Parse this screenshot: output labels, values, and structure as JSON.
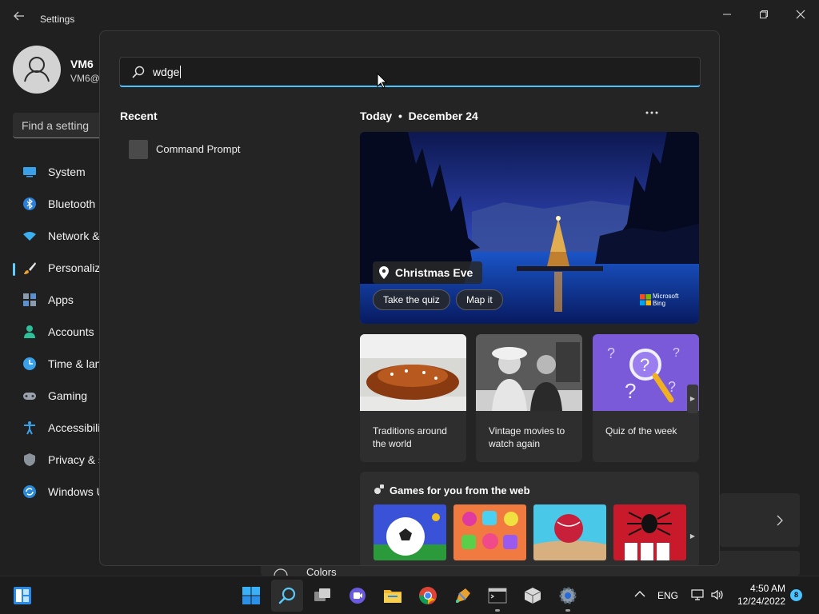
{
  "window": {
    "title": "Settings",
    "user_name": "VM6",
    "user_email": "VM6@",
    "find_placeholder": "Find a setting",
    "nav_items": [
      {
        "label": "System",
        "icon": "monitor-icon"
      },
      {
        "label": "Bluetooth",
        "icon": "bluetooth-icon"
      },
      {
        "label": "Network &",
        "icon": "wifi-icon"
      },
      {
        "label": "Personaliza",
        "icon": "brush-icon"
      },
      {
        "label": "Apps",
        "icon": "apps-icon"
      },
      {
        "label": "Accounts",
        "icon": "person-icon"
      },
      {
        "label": "Time & lan",
        "icon": "clock-icon"
      },
      {
        "label": "Gaming",
        "icon": "gamepad-icon"
      },
      {
        "label": "Accessibili",
        "icon": "accessibility-icon"
      },
      {
        "label": "Privacy & s",
        "icon": "shield-icon"
      },
      {
        "label": "Windows U",
        "icon": "update-icon"
      }
    ],
    "active_nav_index": 3,
    "colors_label": "Colors"
  },
  "search": {
    "query": "wdge",
    "recent_title": "Recent",
    "recent_items": [
      {
        "label": "Command Prompt",
        "icon": "terminal-icon"
      }
    ],
    "today_label": "Today",
    "date_label": "December 24",
    "hero": {
      "title": "Christmas Eve",
      "buttons": [
        "Take the quiz",
        "Map it"
      ],
      "attribution": "Microsoft Bing"
    },
    "cards": [
      {
        "label": "Traditions around the world"
      },
      {
        "label": "Vintage movies to watch again"
      },
      {
        "label": "Quiz of the week"
      }
    ],
    "games_title": "Games for you from the web"
  },
  "taskbar": {
    "language": "ENG",
    "time": "4:50 AM",
    "date": "12/24/2022",
    "notification_count": "8"
  },
  "colors": {
    "accent": "#4cc2ff",
    "background": "#202020",
    "flyout": "#242424",
    "taskbar": "#1c1c1c"
  }
}
